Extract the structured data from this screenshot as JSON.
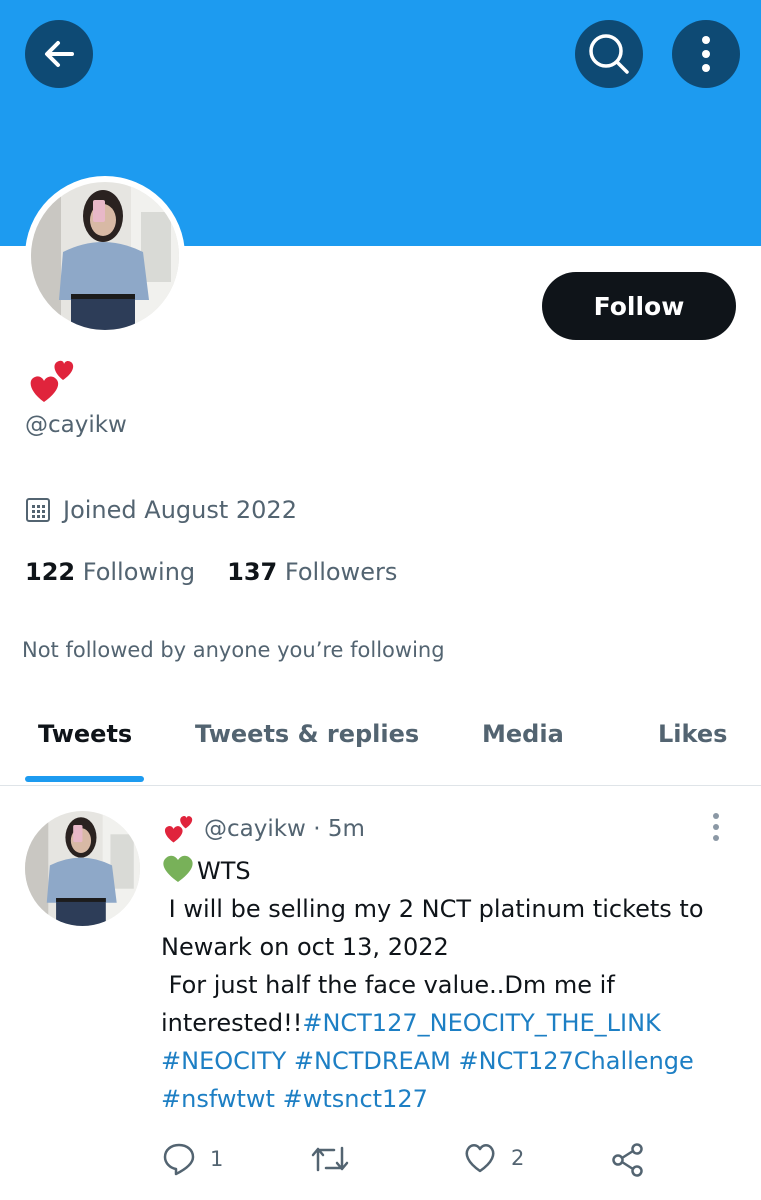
{
  "header": {
    "back_icon": "arrow-left-icon",
    "search_icon": "search-icon",
    "more_icon": "more-vertical-icon",
    "banner_color": "#1d9bf0",
    "button_bg": "#0e4a74"
  },
  "profile": {
    "display_name_emoji": "two-hearts-emoji",
    "handle": "@cayikw",
    "follow_label": "Follow",
    "joined": "Joined August 2022",
    "following_count": "122",
    "following_label": "Following",
    "followers_count": "137",
    "followers_label": "Followers",
    "not_followed": "Not followed by anyone you’re following"
  },
  "tabs": [
    {
      "label": "Tweets",
      "active": true
    },
    {
      "label": "Tweets & replies",
      "active": false
    },
    {
      "label": "Media",
      "active": false
    },
    {
      "label": "Likes",
      "active": false
    }
  ],
  "tweet": {
    "handle": "@cayikw",
    "separator": "·",
    "time": "5m",
    "text_line1": "WTS",
    "text_line2": " I will be selling my 2 NCT platinum tickets to",
    "text_line3": "Newark on oct 13, 2022",
    "text_line4": " For just half the face value..Dm me if",
    "text_line5_plain": "interested!!",
    "hashtag1": "#NCT127_NEOCITY_THE_LINK",
    "hashtag2": "#NEOCITY",
    "hashtag3": "#NCTDREAM",
    "hashtag4": "#NCT127Challenge",
    "hashtag5": "#nsfwtwt",
    "hashtag6": "#wtsnct127",
    "reply_count": "1",
    "retweet_count": "",
    "like_count": "2",
    "link_color": "#1d7fc4"
  }
}
